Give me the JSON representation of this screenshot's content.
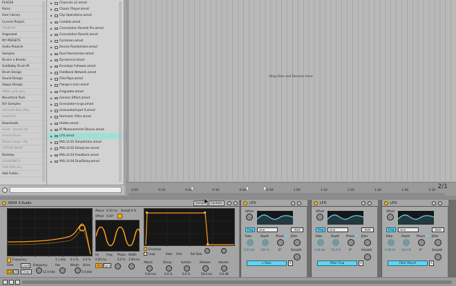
{
  "places": [
    {
      "label": "PLACES",
      "dim": false
    },
    {
      "label": "Packs",
      "dim": false
    },
    {
      "label": "User Library",
      "dim": false
    },
    {
      "label": "Current Project",
      "dim": false
    },
    {
      "label": "FROM MY",
      "dim": true
    },
    {
      "label": "Angenzed",
      "dim": false
    },
    {
      "label": "MY PRESETS",
      "dim": false
    },
    {
      "label": "Audio Projects",
      "dim": false
    },
    {
      "label": "Samples",
      "dim": false
    },
    {
      "label": "Drums n Breaks",
      "dim": false
    },
    {
      "label": "Goldbaby Drum M",
      "dim": false
    },
    {
      "label": "Drum Design",
      "dim": false
    },
    {
      "label": "Sound Design",
      "dim": false
    },
    {
      "label": "Seppe Design",
      "dim": false
    },
    {
      "label": "ANKH_and_and_",
      "dim": true
    },
    {
      "label": "Neurofunk Pack",
      "dim": false
    },
    {
      "label": "Dnl Samples",
      "dim": false
    },
    {
      "label": "Ultimate Bass Mus",
      "dim": true
    },
    {
      "label": "Imported",
      "dim": true
    },
    {
      "label": "Downloads",
      "dim": false
    },
    {
      "label": "Hood - Ichiala me",
      "dim": true
    },
    {
      "label": "Preset Slices",
      "dim": true
    },
    {
      "label": "Phase Loops - Ma",
      "dim": true
    },
    {
      "label": "FUTURE BASS",
      "dim": true
    },
    {
      "label": "Desktop",
      "dim": false
    },
    {
      "label": "SOUNDINFO",
      "dim": true
    },
    {
      "label": "FOR RMX ALL",
      "dim": true
    },
    {
      "label": "Add Folder...",
      "dim": false
    }
  ],
  "files": [
    {
      "label": "Chancels x2.amxd",
      "selected": false
    },
    {
      "label": "Classic Player.amxd",
      "selected": false
    },
    {
      "label": "Clip Operations.amxd",
      "selected": false
    },
    {
      "label": "Combat.amxd",
      "selected": false
    },
    {
      "label": "Convolution Reverb Pro.amxd",
      "selected": false
    },
    {
      "label": "Convolution Reverb.amxd",
      "selected": false
    },
    {
      "label": "Cycleloon.amxd",
      "selected": false
    },
    {
      "label": "Device Randomizer.amxd",
      "selected": false
    },
    {
      "label": "Dual Harmonizer.amxd",
      "selected": false
    },
    {
      "label": "Dynamical.amxd",
      "selected": false
    },
    {
      "label": "Envelope Follower.amxd",
      "selected": false
    },
    {
      "label": "Feedback Network.amxd",
      "selected": false
    },
    {
      "label": "FilterTape.amxd",
      "selected": false
    },
    {
      "label": "Flange-o-tron.amxd",
      "selected": false
    },
    {
      "label": "Fregulator.amxd",
      "selected": false
    },
    {
      "label": "Generic Effect.amxd",
      "selected": false
    },
    {
      "label": "Granulator-ro-go.amxd",
      "selected": false
    },
    {
      "label": "GranulatorInput II.amxd",
      "selected": false
    },
    {
      "label": "Harmonic Filter.amxd",
      "selected": false
    },
    {
      "label": "Holder.amxd",
      "selected": false
    },
    {
      "label": "IR Measurement Device.amxd",
      "selected": false
    },
    {
      "label": "LFO.amxd",
      "selected": true
    },
    {
      "label": "M4L.Ul.01.SimpleGain.amxd",
      "selected": false
    },
    {
      "label": "M4L.Ul.02.DelayLine.amxd",
      "selected": false
    },
    {
      "label": "M4L.Ul.03.Feedback.amxd",
      "selected": false
    },
    {
      "label": "M4L.Ul.04.DualDelay.amxd",
      "selected": false
    }
  ],
  "arrangement": {
    "drop_hint": "Drop Files and Devices Here",
    "ticks": [
      "0:00",
      "0:10",
      "0:20",
      "0:30",
      "0:40",
      "0:50",
      "1:00",
      "1:10",
      "1:20",
      "1:30",
      "1:40",
      "1:50"
    ],
    "tick_fracs": [
      0.0,
      0.085,
      0.17,
      0.255,
      0.34,
      0.425,
      0.51,
      0.595,
      0.68,
      0.765,
      0.85,
      0.935
    ],
    "page_count": "2/1"
  },
  "track": {
    "name": "0004 3-Audio",
    "tabs": [
      "Sample",
      "Controls"
    ],
    "filter": {
      "labels": [
        "Frequency",
        "Res",
        "Morph"
      ],
      "bottom_labels": [
        "Filter",
        "Lowd",
        "Frequency",
        "Res",
        "Morph",
        "Drive"
      ],
      "values": [
        "1.1 kHz",
        "0.1 %",
        "0.0 %"
      ],
      "bottom_values": [
        "12.0 kHz",
        "0.0 %",
        "0.0 kHz"
      ],
      "checkboxes": [
        "12",
        "24"
      ],
      "mode": "Clean"
    },
    "lfo_box": {
      "labels": [
        "Attack",
        "Delay",
        "Offset",
        "Hz",
        "Freq",
        "Phase",
        "Width"
      ],
      "values": [
        "0.10 ms",
        "0.0 %",
        "0.00°",
        "0.00 ms",
        "0.0 %",
        "3.00 ms"
      ],
      "buttons": [
        "Hz",
        "Sync"
      ]
    },
    "env": {
      "labels": [
        "Envelope",
        "Loop",
        "Rate",
        "Amt",
        "Rel Rate",
        "Attack",
        "Decay",
        "Sustain",
        "Release",
        "Volume"
      ],
      "values": [
        "0.00 ms",
        "0.0 %",
        "0.0 %",
        "50.0 ms",
        "0.0 dB"
      ]
    }
  },
  "lfo_devices": [
    {
      "title": "LFO",
      "wave": "sine",
      "rate_label": "Rate",
      "depth_label": "Depth",
      "phase_label": "Phase",
      "jitter_label": "Jitter",
      "smooth_label": "Smooth",
      "rate_value": "0.03 Hz",
      "depth_value": "100 %",
      "phase_value": "0°",
      "map_label": "L Rate",
      "freq_button": "Freq",
      "hold_button": "Hold",
      "offset_label": "Offset"
    },
    {
      "title": "LFO",
      "wave": "sine",
      "rate_label": "Rate",
      "depth_label": "Depth",
      "phase_label": "Phase",
      "jitter_label": "Jitter",
      "smooth_label": "Smooth",
      "rate_value": "0.41 Hz",
      "depth_value": "19.4 %",
      "phase_value": "0°",
      "map_label": "Filter Freq",
      "freq_button": "Freq",
      "hold_button": "Hold",
      "offset_label": "Offset"
    },
    {
      "title": "LFO",
      "wave": "sine",
      "rate_label": "Rate",
      "depth_label": "Depth",
      "phase_label": "Phase",
      "jitter_label": "Jitter",
      "smooth_label": "Smooth",
      "rate_value": "0.49 Hz",
      "depth_value": "18.4 %",
      "phase_value": "0°",
      "map_label": "Filter Morph",
      "freq_button": "Freq",
      "hold_button": "Hold",
      "offset_label": "Offset"
    }
  ],
  "colors": {
    "accent_cyan": "#63d2f0",
    "accent_orange": "#ff9f1c",
    "selection": "#9fe0d6"
  }
}
